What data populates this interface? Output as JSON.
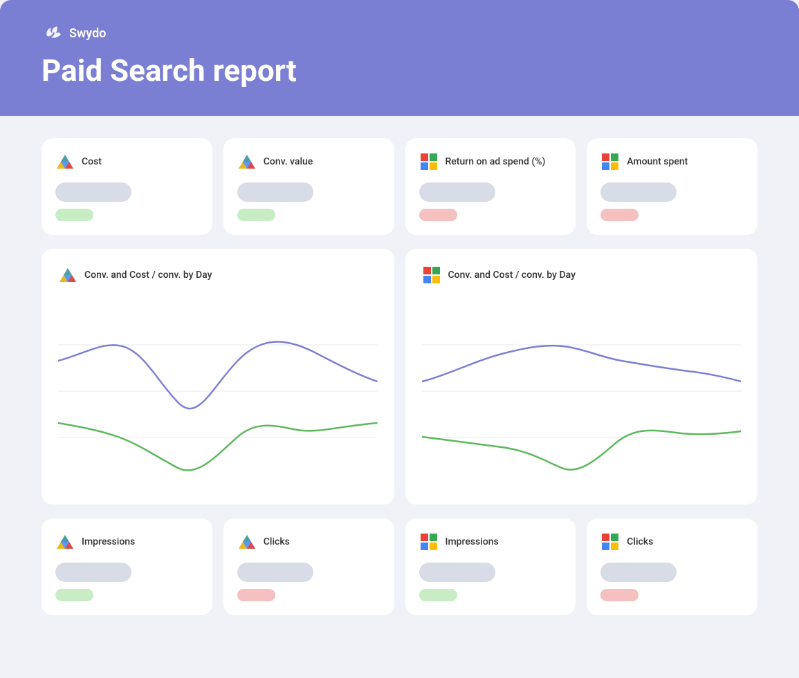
{
  "header": {
    "logo_text": "Swydo",
    "page_title": "Paid Search report"
  },
  "metric_cards": [
    {
      "id": "cost",
      "icon_type": "google-ads",
      "title": "Cost",
      "value_color": "#d8dce6",
      "change_color": "green"
    },
    {
      "id": "conv-value",
      "icon_type": "google-ads",
      "title": "Conv. value",
      "value_color": "#d8dce6",
      "change_color": "green"
    },
    {
      "id": "roas",
      "icon_type": "microsoft",
      "title": "Return on ad spend (%)",
      "value_color": "#d8dce6",
      "change_color": "pink"
    },
    {
      "id": "amount-spent",
      "icon_type": "microsoft",
      "title": "Amount spent",
      "value_color": "#d8dce6",
      "change_color": "pink"
    }
  ],
  "chart_cards": [
    {
      "id": "google-conv-cost",
      "icon_type": "google-ads",
      "title": "Conv. and Cost / conv. by Day"
    },
    {
      "id": "ms-conv-cost",
      "icon_type": "microsoft",
      "title": "Conv. and Cost / conv. by Day"
    }
  ],
  "bottom_cards": [
    {
      "id": "google-impressions",
      "icon_type": "google-ads",
      "title": "Impressions",
      "change_color": "green"
    },
    {
      "id": "google-clicks",
      "icon_type": "google-ads",
      "title": "Clicks",
      "change_color": "pink"
    },
    {
      "id": "ms-impressions",
      "icon_type": "microsoft",
      "title": "Impressions",
      "change_color": "green"
    },
    {
      "id": "ms-clicks",
      "icon_type": "microsoft",
      "title": "Clicks",
      "change_color": "pink"
    }
  ]
}
